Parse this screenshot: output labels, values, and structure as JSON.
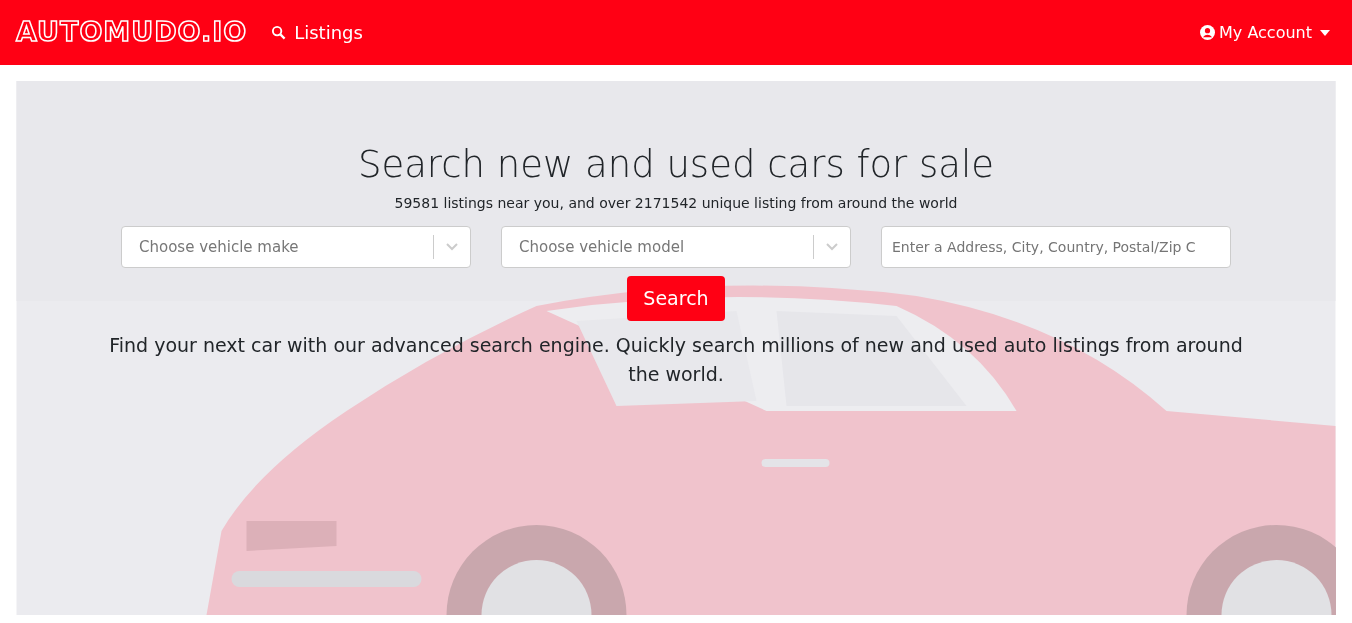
{
  "navbar": {
    "logo": "AUTOMUDO.IO",
    "links": [
      {
        "label": "Listings"
      }
    ],
    "account": {
      "label": "My Account"
    }
  },
  "hero": {
    "kind": "picture",
    "title": "Search new and used cars for sale",
    "subtitle": "59581 listings near you, and over 2171542 unique listing from around the world",
    "fields": [
      {
        "kind": "select",
        "placeholder": "Choose vehicle make"
      },
      {
        "kind": "select",
        "placeholder": "Choose vehicle model"
      },
      {
        "kind": "input",
        "placeholder": "Enter a Address, City, Country, Postal/Zip C"
      }
    ],
    "button": "Search",
    "description": "Find your next car with our advanced search engine. Quickly search millions of new and used auto listings from around the world."
  }
}
